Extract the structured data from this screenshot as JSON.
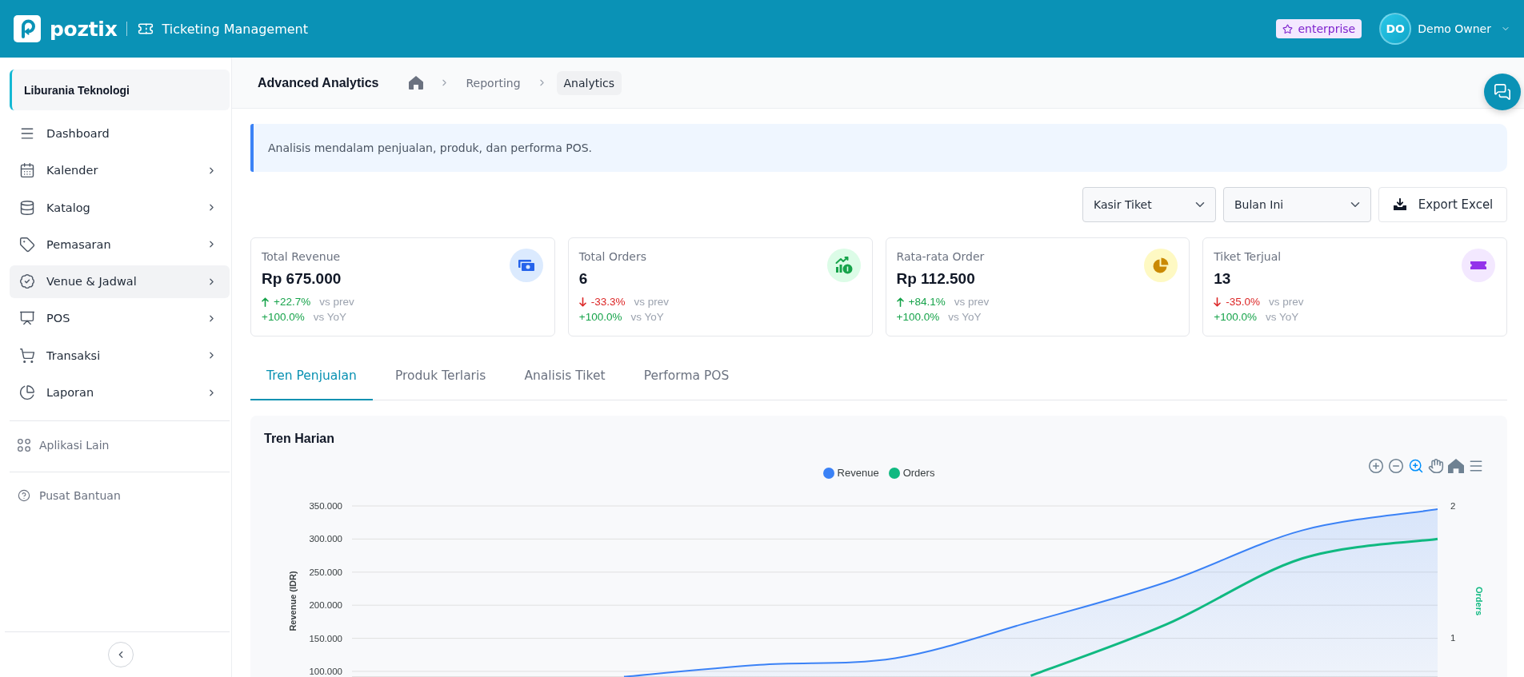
{
  "header": {
    "brand": "poztix",
    "module": "Ticketing Management",
    "plan": "enterprise",
    "user": {
      "initials": "DO",
      "name": "Demo Owner"
    }
  },
  "sidebar": {
    "organization": "Liburania Teknologi",
    "items": [
      {
        "label": "Dashboard",
        "expandable": false,
        "selected": false
      },
      {
        "label": "Kalender",
        "expandable": true,
        "selected": false
      },
      {
        "label": "Katalog",
        "expandable": true,
        "selected": false
      },
      {
        "label": "Pemasaran",
        "expandable": true,
        "selected": false
      },
      {
        "label": "Venue & Jadwal",
        "expandable": true,
        "selected": true
      },
      {
        "label": "POS",
        "expandable": true,
        "selected": false
      },
      {
        "label": "Transaksi",
        "expandable": true,
        "selected": false
      },
      {
        "label": "Laporan",
        "expandable": true,
        "selected": false
      }
    ],
    "links": [
      {
        "label": "Aplikasi Lain"
      },
      {
        "label": "Pusat Bantuan"
      }
    ]
  },
  "breadcrumb": {
    "title": "Advanced Analytics",
    "items": [
      {
        "label": "Reporting",
        "selected": false
      },
      {
        "label": "Analytics",
        "selected": true
      }
    ]
  },
  "banner": "Analisis mendalam penjualan, produk, dan performa POS.",
  "filters": [
    {
      "value": "Kasir Tiket"
    },
    {
      "value": "Bulan Ini"
    }
  ],
  "export_button": "Export Excel",
  "stats": [
    {
      "title": "Total Revenue",
      "value": "Rp 675.000",
      "color": "#2563eb",
      "comparisons": [
        {
          "arrow": true,
          "positive": true,
          "value": "+22.7%",
          "label": "vs prev"
        },
        {
          "arrow": false,
          "positive": true,
          "value": "+100.0%",
          "label": "vs YoY"
        }
      ]
    },
    {
      "title": "Total Orders",
      "value": "6",
      "color": "#16a34a",
      "comparisons": [
        {
          "arrow": true,
          "positive": false,
          "value": "-33.3%",
          "label": "vs prev"
        },
        {
          "arrow": false,
          "positive": true,
          "value": "+100.0%",
          "label": "vs YoY"
        }
      ]
    },
    {
      "title": "Rata-rata Order",
      "value": "Rp 112.500",
      "color": "#ca8a04",
      "comparisons": [
        {
          "arrow": true,
          "positive": true,
          "value": "+84.1%",
          "label": "vs prev"
        },
        {
          "arrow": false,
          "positive": true,
          "value": "+100.0%",
          "label": "vs YoY"
        }
      ]
    },
    {
      "title": "Tiket Terjual",
      "value": "13",
      "color": "#9333ea",
      "comparisons": [
        {
          "arrow": true,
          "positive": false,
          "value": "-35.0%",
          "label": "vs prev"
        },
        {
          "arrow": false,
          "positive": true,
          "value": "+100.0%",
          "label": "vs YoY"
        }
      ]
    }
  ],
  "tabs": [
    {
      "label": "Tren Penjualan",
      "selected": true
    },
    {
      "label": "Produk Terlaris",
      "selected": false
    },
    {
      "label": "Analisis Tiket",
      "selected": false
    },
    {
      "label": "Performa POS",
      "selected": false
    }
  ],
  "chart_panel": {
    "toolbar": [
      {
        "selected": false
      },
      {
        "selected": false
      },
      {
        "selected": true
      },
      {
        "selected": false
      },
      {
        "selected": false
      },
      {
        "selected": false
      }
    ],
    "chart_data": {
      "type": "area",
      "title": "Tren Harian",
      "series": [
        {
          "name": "Revenue",
          "color": "#3b82f6",
          "type": "area",
          "values": [
            92,
            110,
            120,
            175,
            235,
            313,
            345
          ]
        },
        {
          "name": "Orders",
          "color": "#10b981",
          "type": "line",
          "axis": "y2",
          "values": [
            null,
            null,
            null,
            0.71,
            1.1,
            1.6,
            1.75
          ]
        }
      ],
      "grid": true,
      "ylim": [
        91.5,
        350
      ],
      "yticks": [
        {
          "value": 100,
          "label": "100.000"
        },
        {
          "value": 150,
          "label": "150.000"
        },
        {
          "value": 200,
          "label": "200.000"
        },
        {
          "value": 250,
          "label": "250.000"
        },
        {
          "value": 300,
          "label": "300.000"
        },
        {
          "value": 350,
          "label": "350.000"
        }
      ],
      "y2lim": [
        0.7,
        2
      ],
      "y2ticks": [
        1,
        2
      ],
      "ylabel": "Revenue (IDR)"
    },
    "right_axis_title": "Orders"
  }
}
